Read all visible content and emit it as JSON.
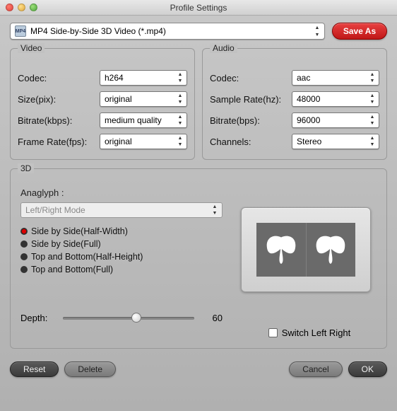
{
  "window": {
    "title": "Profile Settings"
  },
  "profile": {
    "selected": "MP4 Side-by-Side 3D Video (*.mp4)",
    "save_as": "Save As"
  },
  "video": {
    "title": "Video",
    "codec_label": "Codec:",
    "codec": "h264",
    "size_label": "Size(pix):",
    "size": "original",
    "bitrate_label": "Bitrate(kbps):",
    "bitrate": "medium quality",
    "framerate_label": "Frame Rate(fps):",
    "framerate": "original"
  },
  "audio": {
    "title": "Audio",
    "codec_label": "Codec:",
    "codec": "aac",
    "samplerate_label": "Sample Rate(hz):",
    "samplerate": "48000",
    "bitrate_label": "Bitrate(bps):",
    "bitrate": "96000",
    "channels_label": "Channels:",
    "channels": "Stereo"
  },
  "threed": {
    "title": "3D",
    "anaglyph_label": "Anaglyph :",
    "mode": "Left/Right Mode",
    "options": {
      "o1": "Side by Side(Half-Width)",
      "o2": "Side by Side(Full)",
      "o3": "Top and Bottom(Half-Height)",
      "o4": "Top and Bottom(Full)"
    },
    "depth_label": "Depth:",
    "depth_value": "60",
    "switch_label": "Switch Left Right"
  },
  "footer": {
    "reset": "Reset",
    "delete": "Delete",
    "cancel": "Cancel",
    "ok": "OK"
  }
}
